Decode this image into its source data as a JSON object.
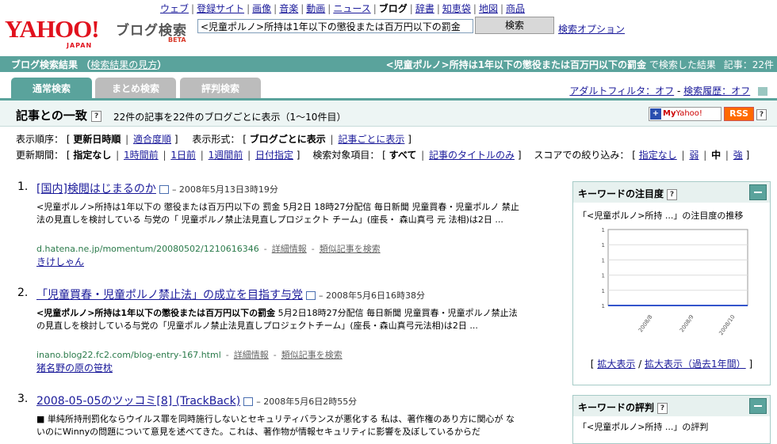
{
  "header": {
    "logo": "YAHOO!",
    "logo_sub": "JAPAN",
    "brand": "ブログ検索",
    "beta": "BETA",
    "nav": [
      {
        "label": "ウェブ",
        "current": false
      },
      {
        "label": "登録サイト",
        "current": false
      },
      {
        "label": "画像",
        "current": false
      },
      {
        "label": "音楽",
        "current": false
      },
      {
        "label": "動画",
        "current": false
      },
      {
        "label": "ニュース",
        "current": false
      },
      {
        "label": "ブログ",
        "current": true
      },
      {
        "label": "辞書",
        "current": false
      },
      {
        "label": "知恵袋",
        "current": false
      },
      {
        "label": "地図",
        "current": false
      },
      {
        "label": "商品",
        "current": false
      }
    ],
    "search_value": "<児童ポルノ>所持は1年以下の懲役または百万円以下の罰金",
    "search_button": "検索",
    "search_options": "検索オプション"
  },
  "result_bar": {
    "title": "ブログ検索結果",
    "help_link": "検索結果の見方",
    "query": "<児童ポルノ>所持は1年以下の懲役または百万円以下の罰金",
    "suffix": "で検索した結果",
    "count_label": "記事：22件"
  },
  "tabs": [
    {
      "label": "通常検索",
      "active": true
    },
    {
      "label": "まとめ検索",
      "active": false
    },
    {
      "label": "評判検索",
      "active": false
    }
  ],
  "adult_filter": "アダルトフィルタ：オフ",
  "history": "検索履歴：オフ",
  "match": {
    "title": "記事との一致",
    "summary": "22件の記事を22件のブログごとに表示（1〜10件目）",
    "myyahoo": "Yahoo!",
    "rss": "RSS"
  },
  "options": {
    "order_label": "表示順序：",
    "order": [
      {
        "label": "更新日時順",
        "current": true
      },
      {
        "label": "適合度順",
        "current": false
      }
    ],
    "format_label": "表示形式：",
    "format": [
      {
        "label": "ブログごとに表示",
        "current": true
      },
      {
        "label": "記事ごとに表示",
        "current": false
      }
    ],
    "period_label": "更新期間：",
    "period": [
      {
        "label": "指定なし",
        "current": true
      },
      {
        "label": "1時間前",
        "current": false
      },
      {
        "label": "1日前",
        "current": false
      },
      {
        "label": "1週間前",
        "current": false
      },
      {
        "label": "日付指定",
        "current": false
      }
    ],
    "target_label": "検索対象項目：",
    "target": [
      {
        "label": "すべて",
        "current": true
      },
      {
        "label": "記事のタイトルのみ",
        "current": false
      }
    ],
    "score_label": "スコアでの絞り込み：",
    "score": [
      {
        "label": "指定なし",
        "current": false
      },
      {
        "label": "弱",
        "current": false
      },
      {
        "label": "中",
        "current": true
      },
      {
        "label": "強",
        "current": false
      }
    ]
  },
  "results": [
    {
      "num": "1.",
      "title": "[国内]検閲はじまるのか",
      "date": "– 2008年5月13日3時19分",
      "snippet": "<児童ポルノ>所持は1年以下の 懲役または百万円以下の 罰金 5月2日 18時27分配信 毎日新聞 児童買春・児童ポルノ 禁止法の見直しを検討している 与党の「 児童ポルノ禁止法見直しプロジェクト チーム」(座長・ 森山真弓 元 法相)は2日 ...",
      "url": "d.hatena.ne.jp/momentum/20080502/1210616346",
      "detail": "詳細情報",
      "similar": "類似記事を検索",
      "author": "きけしゃん"
    },
    {
      "num": "2.",
      "title": "「児童買春・児童ポルノ禁止法」の成立を目指す与党",
      "date": "– 2008年5月6日16時38分",
      "snippet_bold": "<児童ポルノ>所持は1年以下の懲役または百万円以下の罰金",
      "snippet": " 5月2日18時27分配信 毎日新聞 児童買春・児童ポルノ禁止法の見直しを検討している与党の「児童ポルノ禁止法見直しプロジェクトチーム」(座長・森山真弓元法相)は2日 ...",
      "url": "inano.blog22.fc2.com/blog-entry-167.html",
      "detail": "詳細情報",
      "similar": "類似記事を検索",
      "author": "猪名野の原の笹枕"
    },
    {
      "num": "3.",
      "title": "2008-05-05のツッコミ[8] (TrackBack)",
      "date": "– 2008年5月6日2時55分",
      "snippet": "■ 単純所持刑罰化ならウイルス罪を同時施行しないとセキュリティバランスが悪化する 私は、著作権のあり方に関心が ないのにWinnyの問題について意見を述べてきた。これは、著作物が情報セキュリティに影響を及ぼしているからだ"
    }
  ],
  "keyword_panel": {
    "title": "キーワードの注目度",
    "subtitle": "「<児童ポルノ>所持 ...」の注目度の推移",
    "link1": "拡大表示",
    "link2": "拡大表示（過去1年間）",
    "link_open": "[",
    "link_sep": "/",
    "link_close": "]"
  },
  "reputation_panel": {
    "title": "キーワードの評判",
    "subtitle": "「<児童ポルノ>所持 ...」の評判"
  },
  "chart_data": {
    "type": "line",
    "x": [
      "2008/8",
      "2008/9",
      "2008/10"
    ],
    "y_ticks": [
      "1",
      "1",
      "1",
      "1",
      "1",
      "1"
    ],
    "series": [
      {
        "values": [
          0,
          0,
          0,
          0
        ]
      }
    ],
    "ylim": [
      0,
      1
    ],
    "grid": true,
    "line_color": "#3355cc"
  }
}
